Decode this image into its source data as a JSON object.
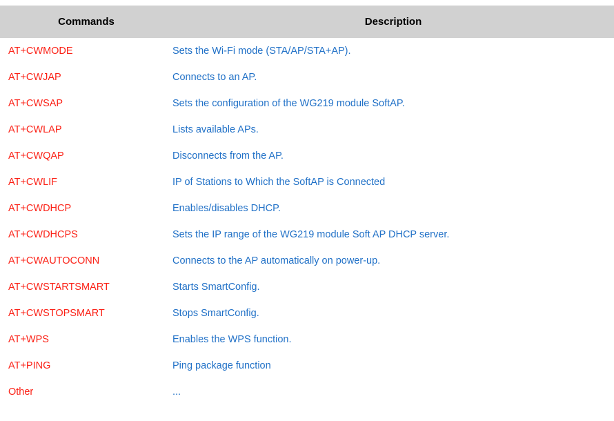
{
  "table": {
    "columns": [
      {
        "key": "command",
        "label": "Commands"
      },
      {
        "key": "description",
        "label": "Description"
      }
    ],
    "header": {
      "commands_label": "Commands",
      "description_label": "Description"
    },
    "colors": {
      "header_background": "#d1d1d1",
      "header_text": "#000000",
      "command_text": "#fb2116",
      "description_text": "#2171c7",
      "page_background": "#ffffff"
    },
    "rows": [
      {
        "command": "AT+CWMODE",
        "description": "Sets the Wi-Fi mode (STA/AP/STA+AP)."
      },
      {
        "command": "AT+CWJAP",
        "description": "Connects to an AP."
      },
      {
        "command": "AT+CWSAP",
        "description": "Sets the configuration of the WG219 module SoftAP."
      },
      {
        "command": "AT+CWLAP",
        "description": "Lists available APs."
      },
      {
        "command": "AT+CWQAP",
        "description": "Disconnects from the AP."
      },
      {
        "command": "AT+CWLIF",
        "description": "IP of Stations to Which the SoftAP is Connected"
      },
      {
        "command": "AT+CWDHCP",
        "description": "Enables/disables DHCP."
      },
      {
        "command": "AT+CWDHCPS",
        "description": "Sets the IP range of the WG219 module Soft AP DHCP server."
      },
      {
        "command": "AT+CWAUTOCONN",
        "description": "Connects to the AP automatically on power-up."
      },
      {
        "command": "AT+CWSTARTSMART",
        "description": "Starts SmartConfig."
      },
      {
        "command": "AT+CWSTOPSMART",
        "description": "Stops SmartConfig."
      },
      {
        "command": "AT+WPS",
        "description": "Enables the WPS function."
      },
      {
        "command": "AT+PING",
        "description": "Ping package function"
      },
      {
        "command": "Other",
        "description": "..."
      }
    ]
  }
}
